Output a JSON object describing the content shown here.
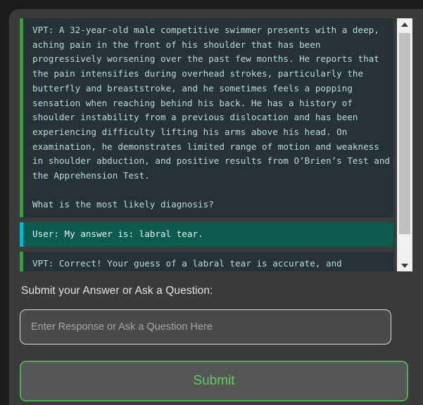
{
  "colors": {
    "page_background": "#1c1c1c",
    "panel_background": "#3b3b3b",
    "message_background": "#263238",
    "message_text": "#b9ded6",
    "vpt_accent": "#3f9c45",
    "user_accent": "#00b8cf",
    "user_background": "#0d5a4e",
    "submit_border": "#4caf50",
    "submit_text": "#63c964",
    "input_border": "#dcdcdc",
    "scrollbar_track": "#f0f0f0",
    "scrollbar_thumb": "#c0c0c0"
  },
  "transcript": {
    "messages": [
      {
        "speaker": "VPT",
        "role": "assistant",
        "text": "VPT: A 32-year-old male competitive swimmer presents with a deep, aching pain in the front of his shoulder that has been progressively worsening over the past few months. He reports that the pain intensifies during overhead strokes, particularly the butterfly and breaststroke, and he sometimes feels a popping sensation when reaching behind his back. He has a history of shoulder instability from a previous dislocation and has been experiencing difficulty lifting his arms above his head. On examination, he demonstrates limited range of motion and weakness in shoulder abduction, and positive results from O’Brien’s Test and the Apprehension Test.\n\nWhat is the most likely diagnosis?"
      },
      {
        "speaker": "User",
        "role": "user",
        "text": "User: My answer is: labral tear."
      },
      {
        "speaker": "VPT",
        "role": "assistant",
        "text": "VPT: Correct! Your guess of a labral tear is accurate, and specifically, it aligns with a SLAP tear, which is common in athletes involved in overhead sports like swimming. The symptoms of deep"
      }
    ]
  },
  "scrollbar": {
    "up_arrow_icon": "triangle-up-icon",
    "down_arrow_icon": "triangle-down-icon",
    "thumb_position_percent": 0,
    "thumb_size_percent": 88
  },
  "form": {
    "label": "Submit your Answer or Ask a Question:",
    "input": {
      "value": "",
      "placeholder": "Enter Response or Ask a Question Here"
    },
    "submit_label": "Submit"
  }
}
